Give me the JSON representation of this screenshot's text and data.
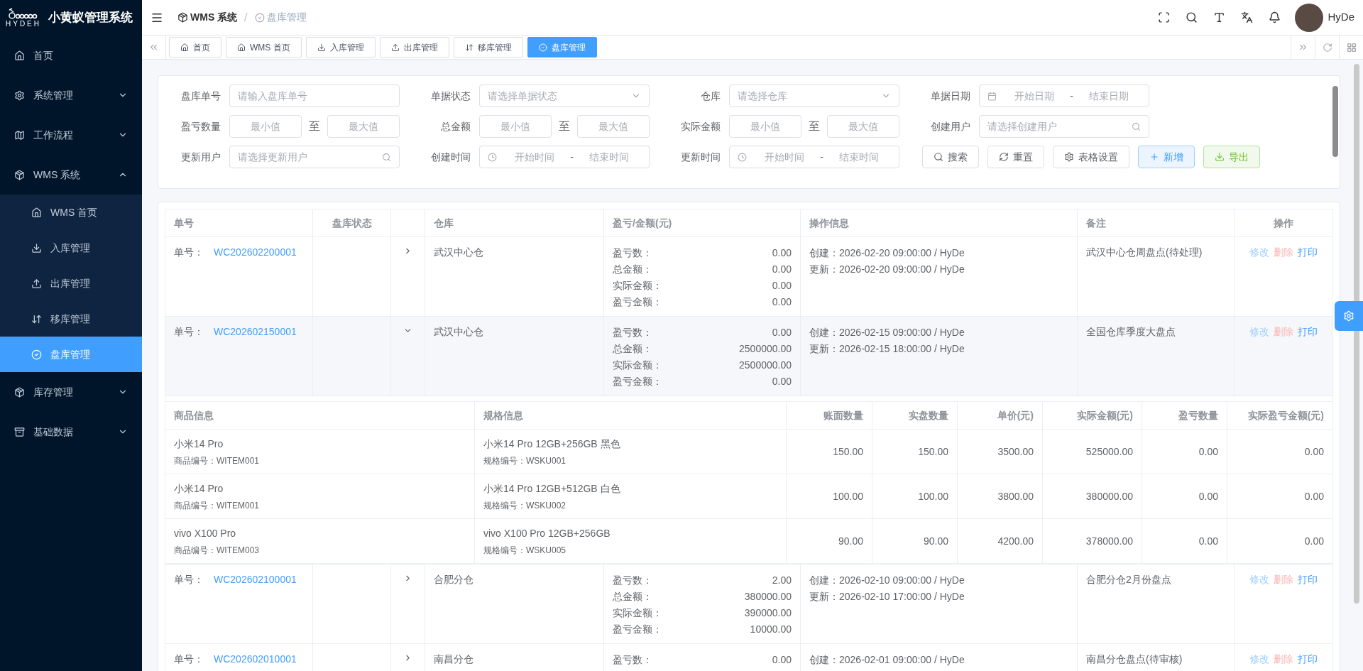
{
  "app": {
    "logo_text": "HYDEH",
    "title": "小黄蚁管理系统"
  },
  "sidebar": {
    "items": [
      {
        "label": "首页",
        "selected": false
      },
      {
        "label": "系统管理",
        "selected": false,
        "expanded": false
      },
      {
        "label": "工作流程",
        "selected": false,
        "expanded": false
      },
      {
        "label": "WMS 系统",
        "selected": false,
        "expanded": true,
        "children": [
          {
            "label": "WMS 首页",
            "selected": false
          },
          {
            "label": "入库管理",
            "selected": false
          },
          {
            "label": "出库管理",
            "selected": false
          },
          {
            "label": "移库管理",
            "selected": false
          },
          {
            "label": "盘库管理",
            "selected": true
          }
        ]
      },
      {
        "label": "库存管理",
        "selected": false,
        "expanded": false
      },
      {
        "label": "基础数据",
        "selected": false,
        "expanded": false
      }
    ]
  },
  "breadcrumb_separator": "/",
  "breadcrumb": [
    {
      "label": "WMS 系统",
      "current": false
    },
    {
      "label": "盘库管理",
      "current": true
    }
  ],
  "user": {
    "name": "HyDe"
  },
  "tabs": [
    {
      "label": "首页",
      "selected": false
    },
    {
      "label": "WMS 首页",
      "selected": false
    },
    {
      "label": "入库管理",
      "selected": false
    },
    {
      "label": "出库管理",
      "selected": false
    },
    {
      "label": "移库管理",
      "selected": false
    },
    {
      "label": "盘库管理",
      "selected": true
    }
  ],
  "filters": [
    {
      "label": "盘库单号",
      "kind": "text",
      "placeholder": "请输入盘库单号"
    },
    {
      "label": "单据状态",
      "kind": "select",
      "placeholder": "请选择单据状态"
    },
    {
      "label": "仓库",
      "kind": "select",
      "placeholder": "请选择仓库"
    },
    {
      "label": "单据日期",
      "kind": "daterange",
      "start_placeholder": "开始日期",
      "separator": "-",
      "end_placeholder": "结束日期"
    },
    {
      "label": "盈亏数量",
      "kind": "range",
      "min_placeholder": "最小值",
      "separator": "至",
      "max_placeholder": "最大值"
    },
    {
      "label": "总金额",
      "kind": "range",
      "min_placeholder": "最小值",
      "separator": "至",
      "max_placeholder": "最大值"
    },
    {
      "label": "实际金额",
      "kind": "range",
      "min_placeholder": "最小值",
      "separator": "至",
      "max_placeholder": "最大值"
    },
    {
      "label": "创建用户",
      "kind": "search",
      "placeholder": "请选择创建用户"
    },
    {
      "label": "更新用户",
      "kind": "search",
      "placeholder": "请选择更新用户"
    },
    {
      "label": "创建时间",
      "kind": "timerange",
      "start_placeholder": "开始时间",
      "separator": "-",
      "end_placeholder": "结束时间"
    },
    {
      "label": "更新时间",
      "kind": "timerange",
      "start_placeholder": "开始时间",
      "separator": "-",
      "end_placeholder": "结束时间"
    }
  ],
  "buttons": [
    {
      "label": "搜索",
      "kind": "default"
    },
    {
      "label": "重置",
      "kind": "default"
    },
    {
      "label": "表格设置",
      "kind": "default"
    },
    {
      "label": "新增",
      "kind": "primary"
    },
    {
      "label": "导出",
      "kind": "success"
    }
  ],
  "table": {
    "columns": [
      "单号",
      "盘库状态",
      "仓库",
      "盈亏/金额(元)",
      "操作信息",
      "备注",
      "操作"
    ],
    "detail_columns": [
      "商品信息",
      "规格信息",
      "账面数量",
      "实盘数量",
      "单价(元)",
      "实际金额(元)",
      "盈亏数量",
      "实际盈亏金额(元)"
    ],
    "rows": [
      {
        "order_label": "单号：",
        "order_no": "WC202602200001",
        "expanded": false,
        "warehouse": "武汉中心仓",
        "stats": [
          {
            "label": "盈亏数：",
            "value": "0.00"
          },
          {
            "label": "总金额：",
            "value": "0.00"
          },
          {
            "label": "实际金额：",
            "value": "0.00"
          },
          {
            "label": "盈亏金额：",
            "value": "0.00"
          }
        ],
        "ops": [
          "创建：2026-02-20 09:00:00 / HyDe",
          "更新：2026-02-20 09:00:00 / HyDe"
        ],
        "remark": "武汉中心仓周盘点(待处理)",
        "actions": [
          {
            "label": "修改",
            "kind": "primary",
            "disabled": true
          },
          {
            "label": "删除",
            "kind": "danger",
            "disabled": true
          },
          {
            "label": "打印",
            "kind": "primary",
            "disabled": false
          }
        ]
      },
      {
        "order_label": "单号：",
        "order_no": "WC202602150001",
        "expanded": true,
        "warehouse": "武汉中心仓",
        "stats": [
          {
            "label": "盈亏数：",
            "value": "0.00"
          },
          {
            "label": "总金额：",
            "value": "2500000.00"
          },
          {
            "label": "实际金额：",
            "value": "2500000.00"
          },
          {
            "label": "盈亏金额：",
            "value": "0.00"
          }
        ],
        "ops": [
          "创建：2026-02-15 09:00:00 / HyDe",
          "更新：2026-02-15 18:00:00 / HyDe"
        ],
        "remark": "全国仓库季度大盘点",
        "actions": [
          {
            "label": "修改",
            "kind": "primary",
            "disabled": true
          },
          {
            "label": "删除",
            "kind": "danger",
            "disabled": true
          },
          {
            "label": "打印",
            "kind": "primary",
            "disabled": false
          }
        ],
        "details": [
          {
            "name": "小米14 Pro",
            "code": "商品编号：WITEM001",
            "spec": "小米14 Pro 12GB+256GB 黑色",
            "spec_code": "规格编号：WSKU001",
            "values": [
              "150.00",
              "150.00",
              "3500.00",
              "525000.00",
              "0.00",
              "0.00"
            ]
          },
          {
            "name": "小米14 Pro",
            "code": "商品编号：WITEM001",
            "spec": "小米14 Pro 12GB+512GB 白色",
            "spec_code": "规格编号：WSKU002",
            "values": [
              "100.00",
              "100.00",
              "3800.00",
              "380000.00",
              "0.00",
              "0.00"
            ]
          },
          {
            "name": "vivo X100 Pro",
            "code": "商品编号：WITEM003",
            "spec": "vivo X100 Pro 12GB+256GB",
            "spec_code": "规格编号：WSKU005",
            "values": [
              "90.00",
              "90.00",
              "4200.00",
              "378000.00",
              "0.00",
              "0.00"
            ]
          }
        ]
      },
      {
        "order_label": "单号：",
        "order_no": "WC202602100001",
        "expanded": false,
        "warehouse": "合肥分仓",
        "stats": [
          {
            "label": "盈亏数：",
            "value": "2.00"
          },
          {
            "label": "总金额：",
            "value": "380000.00"
          },
          {
            "label": "实际金额：",
            "value": "390000.00"
          },
          {
            "label": "盈亏金额：",
            "value": "10000.00"
          }
        ],
        "ops": [
          "创建：2026-02-10 09:00:00 / HyDe",
          "更新：2026-02-10 17:00:00 / HyDe"
        ],
        "remark": "合肥分仓2月份盘点",
        "actions": [
          {
            "label": "修改",
            "kind": "primary",
            "disabled": true
          },
          {
            "label": "删除",
            "kind": "danger",
            "disabled": true
          },
          {
            "label": "打印",
            "kind": "primary",
            "disabled": false
          }
        ]
      },
      {
        "order_label": "单号：",
        "order_no": "WC202602010001",
        "expanded": false,
        "warehouse": "南昌分仓",
        "stats": [
          {
            "label": "盈亏数：",
            "value": "0.00"
          }
        ],
        "ops": [
          "创建：2026-02-01 09:00:00 / HyDe"
        ],
        "remark": "南昌分仓盘点(待审核)",
        "actions": [
          {
            "label": "修改",
            "kind": "primary",
            "disabled": true
          },
          {
            "label": "删除",
            "kind": "danger",
            "disabled": true
          },
          {
            "label": "打印",
            "kind": "primary",
            "disabled": false
          }
        ]
      }
    ]
  }
}
